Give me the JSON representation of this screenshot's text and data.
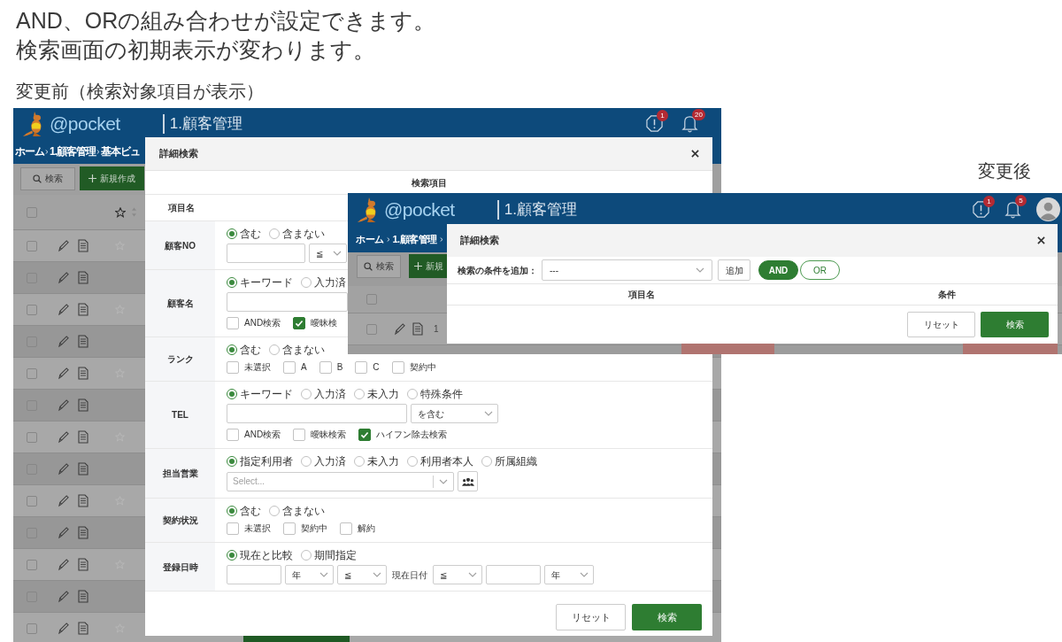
{
  "slide": {
    "headline": [
      "AND、ORの組み合わせが設定できます。",
      "検索画面の初期表示が変わります。"
    ],
    "before_caption": "変更前（検索対象項目が表示）",
    "after_caption": "変更後"
  },
  "before": {
    "app": {
      "logo": "@pocket",
      "title": "1.顧客管理",
      "alert_badge": "1",
      "bell_badge": "20"
    },
    "breadcrumb": [
      "ホーム",
      "1.顧客管理",
      "基本ビュ"
    ],
    "toolbar": {
      "search_button": "検索",
      "new_button": "新規作成"
    },
    "table": {
      "header_checked": false,
      "rows": [
        {
          "checked": false
        },
        {
          "checked": false
        },
        {
          "checked": false
        },
        {
          "checked": false
        },
        {
          "checked": false
        },
        {
          "checked": false
        },
        {
          "checked": false
        },
        {
          "checked": false
        },
        {
          "checked": false
        },
        {
          "checked": false
        },
        {
          "checked": false
        },
        {
          "checked": false
        },
        {
          "checked": false
        }
      ]
    },
    "modal": {
      "title": "詳細検索",
      "section_heading": "検索項目",
      "column_heading": "項目名",
      "fields": [
        {
          "label": "顧客NO",
          "lines": [
            [
              {
                "kind": "radio",
                "label": "含む",
                "selected": true
              },
              {
                "kind": "radio",
                "label": "含まない",
                "selected": false
              }
            ],
            [
              {
                "kind": "input"
              },
              {
                "kind": "select",
                "value": "≦"
              }
            ]
          ]
        },
        {
          "label": "顧客名",
          "lines": [
            [
              {
                "kind": "radio",
                "label": "キーワード",
                "selected": true
              },
              {
                "kind": "radio",
                "label": "入力済",
                "selected": false
              }
            ],
            [
              {
                "kind": "input"
              }
            ],
            [
              {
                "kind": "checkbox",
                "label": "AND検索",
                "checked": false
              },
              {
                "kind": "checkbox",
                "label": "曖昧検",
                "checked": true
              }
            ]
          ]
        },
        {
          "label": "ランク",
          "lines": [
            [
              {
                "kind": "radio",
                "label": "含む",
                "selected": true
              },
              {
                "kind": "radio",
                "label": "含まない",
                "selected": false
              }
            ],
            [
              {
                "kind": "checkbox",
                "label": "未選択",
                "checked": false
              },
              {
                "kind": "checkbox",
                "label": "A",
                "checked": false
              },
              {
                "kind": "checkbox",
                "label": "B",
                "checked": false
              },
              {
                "kind": "checkbox",
                "label": "C",
                "checked": false
              },
              {
                "kind": "checkbox",
                "label": "契約中",
                "checked": false
              }
            ]
          ]
        },
        {
          "label": "TEL",
          "lines": [
            [
              {
                "kind": "radio",
                "label": "キーワード",
                "selected": true
              },
              {
                "kind": "radio",
                "label": "入力済",
                "selected": false
              },
              {
                "kind": "radio",
                "label": "未入力",
                "selected": false
              },
              {
                "kind": "radio",
                "label": "特殊条件",
                "selected": false
              }
            ],
            [
              {
                "kind": "input"
              },
              {
                "kind": "select",
                "value": "を含む"
              }
            ],
            [
              {
                "kind": "checkbox",
                "label": "AND検索",
                "checked": false
              },
              {
                "kind": "checkbox",
                "label": "曖昧検索",
                "checked": false
              },
              {
                "kind": "checkbox",
                "label": "ハイフン除去検索",
                "checked": true
              }
            ]
          ]
        },
        {
          "label": "担当営業",
          "lines": [
            [
              {
                "kind": "radio",
                "label": "指定利用者",
                "selected": true
              },
              {
                "kind": "radio",
                "label": "入力済",
                "selected": false
              },
              {
                "kind": "radio",
                "label": "未入力",
                "selected": false
              },
              {
                "kind": "radio",
                "label": "利用者本人",
                "selected": false
              },
              {
                "kind": "radio",
                "label": "所属組織",
                "selected": false
              }
            ],
            [
              {
                "kind": "combobox",
                "placeholder": "Select..."
              },
              {
                "kind": "icon_button"
              }
            ]
          ]
        },
        {
          "label": "契約状況",
          "lines": [
            [
              {
                "kind": "radio",
                "label": "含む",
                "selected": true
              },
              {
                "kind": "radio",
                "label": "含まない",
                "selected": false
              }
            ],
            [
              {
                "kind": "checkbox",
                "label": "未選択",
                "checked": false
              },
              {
                "kind": "checkbox",
                "label": "契約中",
                "checked": false
              },
              {
                "kind": "checkbox",
                "label": "解約",
                "checked": false
              }
            ]
          ]
        },
        {
          "label": "登録日時",
          "lines": [
            [
              {
                "kind": "radio",
                "label": "現在と比較",
                "selected": true
              },
              {
                "kind": "radio",
                "label": "期間指定",
                "selected": false
              }
            ],
            [
              {
                "kind": "input"
              },
              {
                "kind": "select",
                "value": "年"
              },
              {
                "kind": "select",
                "value": "≦"
              },
              {
                "kind": "text",
                "text": "現在日付"
              },
              {
                "kind": "select",
                "value": "≦"
              },
              {
                "kind": "input"
              },
              {
                "kind": "select",
                "value": "年"
              }
            ]
          ]
        }
      ],
      "buttons": {
        "reset": "リセット",
        "search": "検索"
      }
    }
  },
  "after": {
    "app": {
      "logo": "@pocket",
      "title": "1.顧客管理",
      "alert_badge": "1",
      "bell_badge": "5"
    },
    "breadcrumb": [
      "ホーム",
      "1.顧客管理"
    ],
    "toolbar": {
      "search_button": "検索",
      "new_button": "新規"
    },
    "table": {
      "header_checked": false,
      "rows": [
        {
          "checked": false,
          "first_cell": "1"
        }
      ]
    },
    "modal": {
      "title": "詳細検索",
      "add_condition": {
        "label": "検索の条件を追加：",
        "select_value": "---",
        "add_button": "追加"
      },
      "logic": [
        {
          "label": "AND",
          "selected": true
        },
        {
          "label": "OR",
          "selected": false
        }
      ],
      "columns": [
        "項目名",
        "条件"
      ],
      "buttons": {
        "reset": "リセット",
        "search": "検索"
      }
    }
  }
}
